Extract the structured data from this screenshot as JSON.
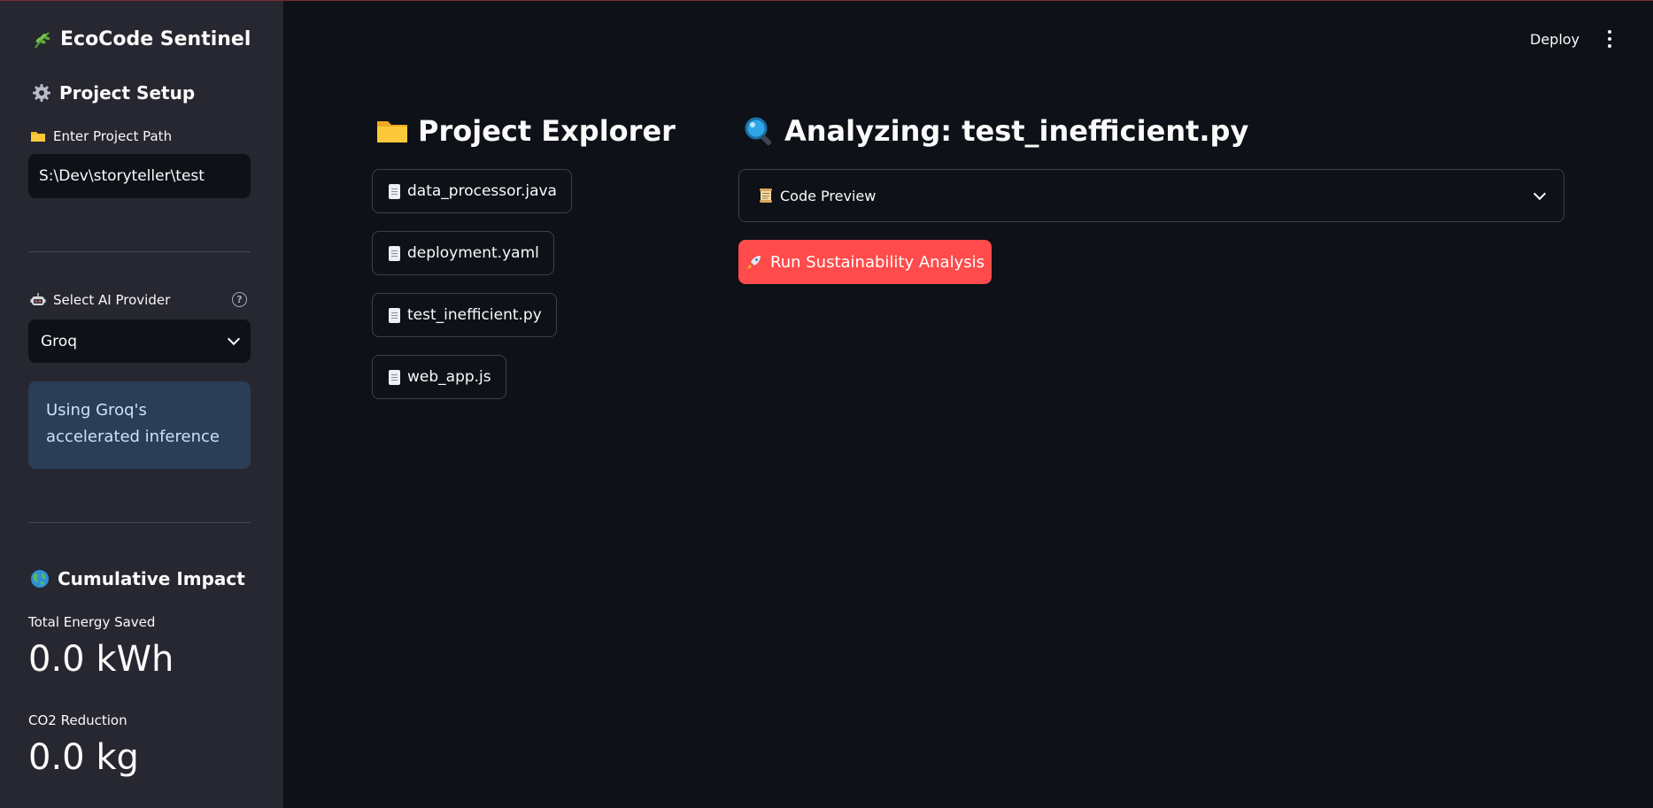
{
  "sidebar": {
    "app_title": "EcoCode Sentinel",
    "project_setup_heading": "Project Setup",
    "project_path_label": "Enter Project Path",
    "project_path_value": "S:\\Dev\\storyteller\\test",
    "provider_label": "Select AI Provider",
    "provider_value": "Groq",
    "provider_info": "Using Groq's accelerated inference",
    "impact_heading": "Cumulative Impact",
    "energy_label": "Total Energy Saved",
    "energy_value": "0.0 kWh",
    "co2_label": "CO2 Reduction",
    "co2_value": "0.0 kg"
  },
  "header": {
    "deploy_label": "Deploy"
  },
  "explorer": {
    "title": "Project Explorer",
    "files": [
      "data_processor.java",
      "deployment.yaml",
      "test_inefficient.py",
      "web_app.js"
    ]
  },
  "analysis": {
    "title": "Analyzing: test_inefficient.py",
    "code_preview_label": "Code Preview",
    "run_button_label": "Run Sustainability Analysis"
  },
  "colors": {
    "sidebar_bg": "#262730",
    "main_bg": "#0e1117",
    "accent": "#ff4b4b",
    "info_bg": "#2b3d57",
    "info_text": "#c7e3fb"
  }
}
